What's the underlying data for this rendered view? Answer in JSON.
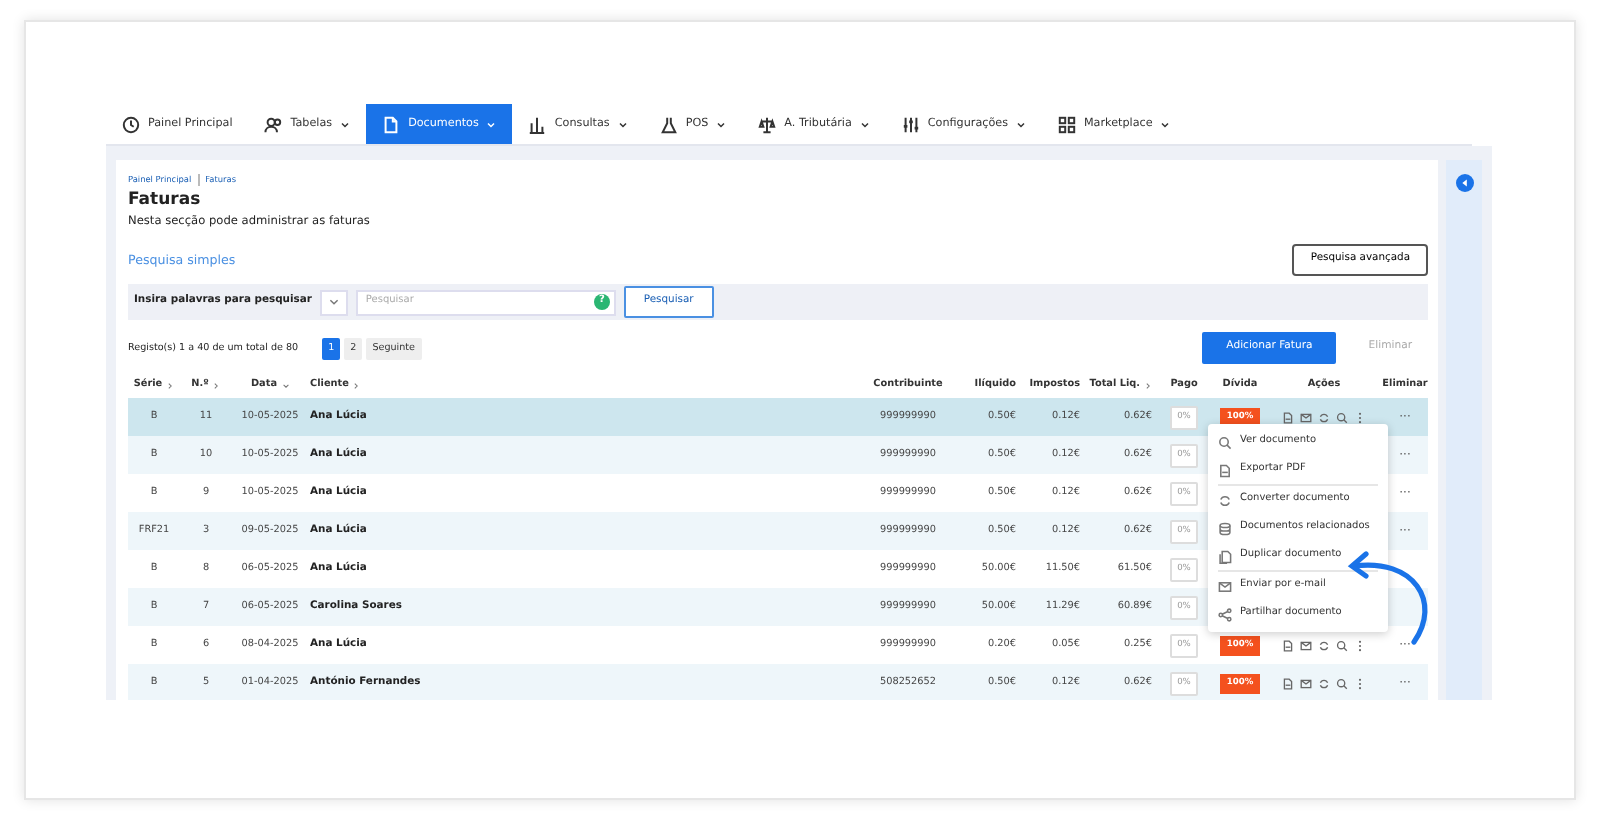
{
  "nav": [
    {
      "label": "Painel Principal",
      "dropdown": false,
      "selected": false
    },
    {
      "label": "Tabelas",
      "dropdown": true,
      "selected": false
    },
    {
      "label": "Documentos",
      "dropdown": true,
      "selected": true
    },
    {
      "label": "Consultas",
      "dropdown": true,
      "selected": false
    },
    {
      "label": "POS",
      "dropdown": true,
      "selected": false
    },
    {
      "label": "A. Tributária",
      "dropdown": true,
      "selected": false
    },
    {
      "label": "Configurações",
      "dropdown": true,
      "selected": false
    },
    {
      "label": "Marketplace",
      "dropdown": true,
      "selected": false
    }
  ],
  "breadcrumb": [
    "Painel Principal",
    "Faturas"
  ],
  "title": "Faturas",
  "subtitle": "Nesta secção pode administrar as faturas",
  "simple_search_label": "Pesquisa simples",
  "advanced_search_button": "Pesquisa avançada",
  "search": {
    "label": "Insira palavras para pesquisar",
    "placeholder": "Pesquisar",
    "help": "?",
    "button": "Pesquisar"
  },
  "pagination": {
    "summary": "Registo(s) 1 a 40 de um total de 80",
    "pages": [
      {
        "label": "1",
        "selected": true
      },
      {
        "label": "2",
        "selected": false
      }
    ],
    "next": "Seguinte"
  },
  "add_button": "Adicionar Fatura",
  "delete_button": {
    "label": "Eliminar",
    "disabled": true
  },
  "table": {
    "columns": [
      {
        "label": "Série",
        "sortable": true,
        "sorted": false
      },
      {
        "label": "N.º",
        "sortable": true,
        "sorted": false
      },
      {
        "label": "Data",
        "sortable": true,
        "sorted": true
      },
      {
        "label": "Cliente",
        "sortable": true,
        "sorted": false
      },
      {
        "label": "Contribuinte"
      },
      {
        "label": "Ilíquido"
      },
      {
        "label": "Impostos"
      },
      {
        "label": "Total Liq.",
        "sortable": true,
        "sorted": false
      },
      {
        "label": "Pago"
      },
      {
        "label": "Dívida"
      },
      {
        "label": "Ações"
      },
      {
        "label": "Eliminar"
      }
    ],
    "rows": [
      {
        "serie": "B",
        "number": "11",
        "date": "10-05-2025",
        "client": "Ana Lúcia",
        "taxpayer": "999999990",
        "net": "0.50€",
        "taxes": "0.12€",
        "total": "0.62€",
        "paid": "0%",
        "debt": "100%",
        "actions": true,
        "more": "···",
        "selected": true
      },
      {
        "serie": "B",
        "number": "10",
        "date": "10-05-2025",
        "client": "Ana Lúcia",
        "taxpayer": "999999990",
        "net": "0.50€",
        "taxes": "0.12€",
        "total": "0.62€",
        "paid": "0%",
        "actions": false,
        "more": "···",
        "selected": false
      },
      {
        "serie": "B",
        "number": "9",
        "date": "10-05-2025",
        "client": "Ana Lúcia",
        "taxpayer": "999999990",
        "net": "0.50€",
        "taxes": "0.12€",
        "total": "0.62€",
        "paid": "0%",
        "actions": false,
        "more": "···",
        "selected": false
      },
      {
        "serie": "FRF21",
        "number": "3",
        "date": "09-05-2025",
        "client": "Ana Lúcia",
        "taxpayer": "999999990",
        "net": "0.50€",
        "taxes": "0.12€",
        "total": "0.62€",
        "paid": "0%",
        "actions": false,
        "more": "···",
        "selected": false
      },
      {
        "serie": "B",
        "number": "8",
        "date": "06-05-2025",
        "client": "Ana Lúcia",
        "taxpayer": "999999990",
        "net": "50.00€",
        "taxes": "11.50€",
        "total": "61.50€",
        "paid": "0%",
        "actions": false,
        "selected": false
      },
      {
        "serie": "B",
        "number": "7",
        "date": "06-05-2025",
        "client": "Carolina Soares",
        "taxpayer": "999999990",
        "net": "50.00€",
        "taxes": "11.29€",
        "total": "60.89€",
        "paid": "0%",
        "actions": false,
        "selected": false
      },
      {
        "serie": "B",
        "number": "6",
        "date": "08-04-2025",
        "client": "Ana Lúcia",
        "taxpayer": "999999990",
        "net": "0.20€",
        "taxes": "0.05€",
        "total": "0.25€",
        "paid": "0%",
        "debt": "100%",
        "actions": true,
        "more": "···",
        "selected": false
      },
      {
        "serie": "B",
        "number": "5",
        "date": "01-04-2025",
        "client": "António Fernandes",
        "taxpayer": "508252652",
        "net": "0.50€",
        "taxes": "0.12€",
        "total": "0.62€",
        "paid": "0%",
        "debt": "100%",
        "actions": true,
        "more": "···",
        "selected": false
      }
    ]
  },
  "context_menu": {
    "items": [
      {
        "label": "Ver documento",
        "divider_after": false
      },
      {
        "label": "Exportar PDF",
        "divider_after": true
      },
      {
        "label": "Converter documento",
        "divider_after": false
      },
      {
        "label": "Documentos relacionados",
        "divider_after": false
      },
      {
        "label": "Duplicar documento",
        "divider_after": true
      },
      {
        "label": "Enviar por e-mail",
        "divider_after": false
      },
      {
        "label": "Partilhar documento",
        "divider_after": false
      }
    ]
  }
}
